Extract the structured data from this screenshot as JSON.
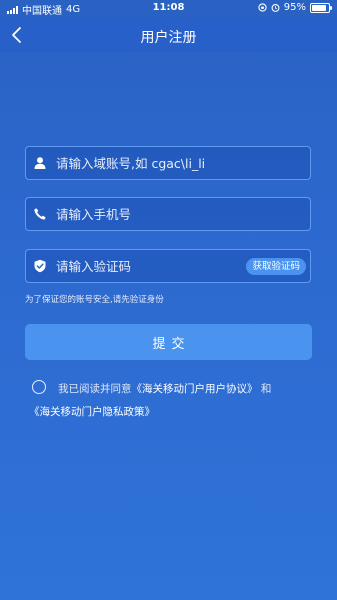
{
  "status_bar": {
    "carrier": "中国联通",
    "network": "4G",
    "time": "11:08",
    "battery_percent": "95%",
    "battery_level": 0.95
  },
  "nav": {
    "title": "用户注册",
    "back_icon": "chevron-left-icon"
  },
  "form": {
    "account": {
      "placeholder": "请输入域账号,如 cgac\\li_li",
      "value": "",
      "icon": "user-icon"
    },
    "phone": {
      "placeholder": "请输入手机号",
      "value": "",
      "icon": "phone-icon"
    },
    "code": {
      "placeholder": "请输入验证码",
      "value": "",
      "icon": "shield-icon",
      "get_code_label": "获取验证码"
    },
    "hint": "为了保证您的账号安全,请先验证身份",
    "submit_label": "提交"
  },
  "agreement": {
    "prefix": "我已阅读并同意",
    "user_agreement": "《海关移动门户用户协议》",
    "conjunction": "和",
    "privacy_policy": "《海关移动门户隐私政策》",
    "checked": false
  },
  "colors": {
    "background": "#2d6ad0",
    "nav_background": "#2660c8",
    "field_border": "#5e9bf0",
    "button": "#4a94f0"
  }
}
